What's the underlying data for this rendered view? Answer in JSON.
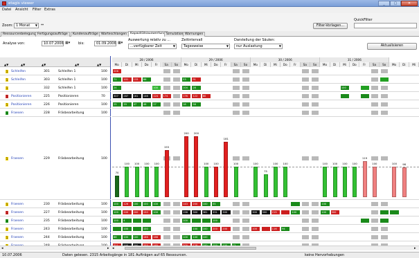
{
  "window": {
    "title": "etagis viewer"
  },
  "menu": [
    "Datei",
    "Ansicht",
    "Filter",
    "Extras"
  ],
  "toolbar": {
    "zoom_label": "Zoom:",
    "zoom_value": "1 Monat",
    "filter_button": "Filter-Vorlagen...",
    "quickfilter_label": "QuickFilter",
    "quickfilter_value": ""
  },
  "tabs": [
    {
      "label": "Ressourcenbelegung",
      "active": false
    },
    {
      "label": "Fertigungsaufträge",
      "active": false
    },
    {
      "label": "Kundenaufträge",
      "active": false
    },
    {
      "label": "Warteschlangen",
      "active": false
    },
    {
      "label": "Kapazitätsauswertung",
      "active": true
    },
    {
      "label": "Simulation",
      "active": false
    },
    {
      "label": "Warnungen",
      "active": false
    }
  ],
  "filters": {
    "analyse_label": "Analyse von:",
    "analyse_value": "10.07.2006",
    "bis_label": "bis:",
    "bis_value": "01.09.2006",
    "auswertung_label": "Auswertung relativ zu ...",
    "auswertung_value": "...verfügbarer Zeit",
    "zeitintervall_label": "Zeitintervall",
    "zeitintervall_value": "Tagesweise",
    "darstellung_label": "Darstellung der Säulen:",
    "darstellung_value": "nur Auslastung",
    "refresh_button": "Aktualisieren"
  },
  "weeks": [
    "28 / 2006",
    "29 / 2006",
    "30 / 2006",
    "31 / 2006"
  ],
  "days": [
    "Mo",
    "Di",
    "Mi",
    "Do",
    "Fr",
    "Sa",
    "So",
    "Mo",
    "Di",
    "Mi",
    "Do",
    "Fr",
    "Sa",
    "So",
    "Mo",
    "Di",
    "Mi",
    "Do",
    "Fr",
    "Sa",
    "So",
    "Mo",
    "Di",
    "Mi",
    "Do",
    "Fr",
    "Sa",
    "So",
    "Mo",
    "Di",
    "Mi"
  ],
  "rows": [
    {
      "pri": "1",
      "pri_color": "#f0d000",
      "name": "Schleifen",
      "nr": "301",
      "desc": "Schleifen 1",
      "cap": "100",
      "segs": [
        [
          "#cc1f1f",
          "206",
          0
        ]
      ]
    },
    {
      "pri": "1",
      "pri_color": "#f0d000",
      "name": "Schleifen",
      "nr": "303",
      "desc": "Schleifen 1",
      "cap": "100",
      "segs": [
        [
          "#1a8a1a",
          "71",
          0
        ],
        [
          "#cc1f1f",
          "101",
          1
        ],
        [
          "#cc1f1f",
          "133",
          2
        ],
        [
          "#1a8a1a",
          "66",
          3
        ],
        [
          "#1a8a1a",
          "53",
          7
        ],
        [
          "#cc1f1f",
          "91",
          8
        ],
        [
          "#22a022",
          "",
          27
        ]
      ]
    },
    {
      "pri": "1",
      "pri_color": "#f0d000",
      "name": "",
      "nr": "332",
      "desc": "Schleifen 1",
      "cap": "100",
      "segs": [
        [
          "#1a8a1a",
          "24",
          0
        ],
        [
          "#33b533",
          "100",
          4
        ],
        [
          "#1a8a1a",
          "104",
          7
        ],
        [
          "#1a8a1a",
          "28",
          8
        ],
        [
          "#1a8a1a",
          "100",
          23
        ],
        [
          "#22a022",
          "",
          25
        ]
      ]
    },
    {
      "pri": "1",
      "pri_color": "#e03030",
      "name": "Positionieren",
      "nr": "225",
      "desc": "Positionieren",
      "cap": "70",
      "segs": [
        [
          "#111",
          "307",
          0
        ],
        [
          "#111",
          "287",
          1
        ],
        [
          "#111",
          "161",
          2
        ],
        [
          "#111",
          "146",
          3
        ],
        [
          "#cc1f1f",
          "124",
          4
        ],
        [
          "#cc1f1f",
          "174",
          5
        ],
        [
          "#cc1f1f",
          "176",
          7
        ],
        [
          "#cc1f1f",
          "122",
          8
        ],
        [
          "#cc1f1f",
          "80",
          9
        ],
        [
          "#1a8a1a",
          "",
          23
        ],
        [
          "#1a8a1a",
          "",
          25
        ]
      ]
    },
    {
      "pri": "1",
      "pri_color": "#f0d000",
      "name": "Positionieren",
      "nr": "226",
      "desc": "Positionieren",
      "cap": "100",
      "segs": [
        [
          "#1a8a1a",
          "25",
          0
        ],
        [
          "#1a8a1a",
          "39",
          1
        ],
        [
          "#1a8a1a",
          "47",
          2
        ],
        [
          "#1a8a1a",
          "48",
          3
        ],
        [
          "#1a8a1a",
          "27",
          4
        ],
        [
          "#1a8a1a",
          "18",
          7
        ],
        [
          "#1a8a1a",
          "58",
          8
        ]
      ]
    },
    {
      "pri": "1",
      "pri_color": "#22a022",
      "name": "Fraesen",
      "nr": "228",
      "desc": "Fräsbearbeitung",
      "cap": "100",
      "segs": []
    },
    {
      "pri": "1",
      "pri_color": "#f0d000",
      "name": "Fraesen",
      "nr": "229",
      "desc": "Fräsbearbeitung",
      "cap": "100",
      "segs": []
    },
    {
      "pri": "1",
      "pri_color": "#f0d000",
      "name": "Fraesen",
      "nr": "230",
      "desc": "Fräsbearbeitung",
      "cap": "100",
      "segs": [
        [
          "#1a8a1a",
          "100",
          0
        ],
        [
          "#cc1f1f",
          "126",
          1
        ],
        [
          "#1a8a1a",
          "100",
          2
        ],
        [
          "#1a8a1a",
          "100",
          3
        ],
        [
          "#1a8a1a",
          "100",
          4
        ],
        [
          "#cc1f1f",
          "143",
          7
        ],
        [
          "#cc1f1f",
          "200",
          8
        ],
        [
          "#1a8a1a",
          "100",
          9
        ],
        [
          "#1a8a1a",
          "55",
          10
        ],
        [
          "#1a8a1a",
          "",
          18
        ],
        [
          "#1a8a1a",
          "100",
          21
        ]
      ]
    },
    {
      "pri": "1",
      "pri_color": "#e03030",
      "name": "Fraesen",
      "nr": "227",
      "desc": "Fräsbearbeitung",
      "cap": "100",
      "segs": [
        [
          "#1a8a1a",
          "100",
          0
        ],
        [
          "#cc1f1f",
          "200",
          1
        ],
        [
          "#cc1f1f",
          "200",
          2
        ],
        [
          "#cc1f1f",
          "150",
          3
        ],
        [
          "#1a8a1a",
          "100",
          4
        ],
        [
          "#111",
          "158",
          7
        ],
        [
          "#111",
          "300",
          8
        ],
        [
          "#111",
          "361",
          9
        ],
        [
          "#111",
          "331",
          10
        ],
        [
          "#111",
          "300",
          11
        ],
        [
          "#111",
          "300",
          14
        ],
        [
          "#111",
          "300",
          15
        ],
        [
          "#cc1f1f",
          "215",
          16
        ],
        [
          "#cc1f1f",
          "",
          17
        ],
        [
          "#1a8a1a",
          "100",
          18
        ],
        [
          "#1a8a1a",
          "100",
          21
        ],
        [
          "#cc1f1f",
          "300",
          22
        ],
        [
          "#1a8a1a",
          "",
          27
        ],
        [
          "#1a8a1a",
          "",
          28
        ]
      ]
    },
    {
      "pri": "1",
      "pri_color": "#22a022",
      "name": "Fraesen",
      "nr": "235",
      "desc": "Fräsbearbeitung",
      "cap": "100",
      "segs": [
        [
          "#1a8a1a",
          "100",
          0
        ],
        [
          "#1a8a1a",
          "4",
          1
        ],
        [
          "#1a8a1a",
          "",
          2
        ],
        [
          "#1a8a1a",
          "",
          3
        ],
        [
          "#1a8a1a",
          "100",
          7
        ],
        [
          "#1a8a1a",
          "",
          8
        ],
        [
          "#1a8a1a",
          "",
          9
        ],
        [
          "#1a8a1a",
          "100",
          10
        ],
        [
          "#1a8a1a",
          "",
          25
        ],
        [
          "#1a8a1a",
          "",
          27
        ]
      ]
    },
    {
      "pri": "1",
      "pri_color": "#f0d000",
      "name": "Fraesen",
      "nr": "243",
      "desc": "Fräsbearbeitung",
      "cap": "100",
      "segs": [
        [
          "#1a8a1a",
          "",
          0
        ],
        [
          "#1a8a1a",
          "100",
          1
        ],
        [
          "#1a8a1a",
          "",
          2
        ],
        [
          "#1a8a1a",
          "100",
          3
        ],
        [
          "#1a8a1a",
          "100",
          8
        ],
        [
          "#1a8a1a",
          "100",
          9
        ],
        [
          "#cc1f1f",
          "200",
          10
        ],
        [
          "#cc1f1f",
          "200",
          11
        ],
        [
          "#cc1f1f",
          "100",
          14
        ],
        [
          "#cc1f1f",
          "",
          15
        ],
        [
          "#cc1f1f",
          "116",
          16
        ],
        [
          "#1a8a1a",
          "94",
          17
        ]
      ]
    },
    {
      "pri": "1",
      "pri_color": "#f0d000",
      "name": "Fraesen",
      "nr": "244",
      "desc": "Fräsbearbeitung",
      "cap": "100",
      "segs": [
        [
          "#1a8a1a",
          "86",
          0
        ],
        [
          "#1a8a1a",
          "100",
          1
        ],
        [
          "#1a8a1a",
          "100",
          2
        ],
        [
          "#cc1f1f",
          "166",
          3
        ],
        [
          "#cc1f1f",
          "166",
          4
        ],
        [
          "#1a8a1a",
          "100",
          7
        ],
        [
          "#1a8a1a",
          "100",
          8
        ],
        [
          "#1a8a1a",
          "100",
          9
        ]
      ]
    },
    {
      "pri": "1",
      "pri_color": "#f0d000",
      "name": "Fraesen",
      "nr": "248",
      "desc": "Fräsbearbeitung",
      "cap": "100",
      "segs": [
        [
          "#cc1f1f",
          "311",
          0
        ],
        [
          "#111",
          "200",
          1
        ],
        [
          "#111",
          "200",
          2
        ],
        [
          "#cc1f1f",
          "255",
          3
        ],
        [
          "#cc1f1f",
          "165",
          4
        ],
        [
          "#cc1f1f",
          "200",
          7
        ],
        [
          "#cc1f1f",
          "128",
          8
        ],
        [
          "#1a8a1a",
          "100",
          9
        ],
        [
          "#1a8a1a",
          "100",
          10
        ],
        [
          "#1a8a1a",
          "100",
          11
        ],
        [
          "#1a8a1a",
          "13",
          12
        ]
      ]
    }
  ],
  "big_chart": {
    "labels": [
      "70",
      "100",
      "100",
      "100",
      "100",
      "155",
      "200",
      "200",
      "100",
      "100",
      "181",
      "100",
      "100",
      "75",
      "100",
      "100",
      "100",
      "100",
      "100",
      "100",
      "119",
      "100",
      "100",
      "98"
    ],
    "values": [
      70,
      100,
      100,
      100,
      100,
      155,
      200,
      200,
      100,
      100,
      181,
      100,
      100,
      75,
      100,
      100,
      100,
      100,
      100,
      100,
      119,
      100,
      100,
      98
    ],
    "colors": [
      "#1a6a1a",
      "#33c033",
      "#33c033",
      "#33c033",
      "#33c033",
      "#e02020",
      "#e02020",
      "#e02020",
      "#33c033",
      "#e02020",
      "#e02020",
      "#33c033",
      "#33c033",
      "#33c033",
      "#33c033",
      "#33c033",
      "#33c033",
      "#33c033",
      "#33c033",
      "#33c033",
      "#f08080",
      "#f08080",
      "#f08080",
      "#f08080"
    ],
    "day_index": [
      0,
      1,
      2,
      3,
      4,
      5,
      7,
      8,
      9,
      10,
      11,
      12,
      14,
      15,
      16,
      17,
      21,
      22,
      23,
      24,
      25,
      26,
      28,
      29
    ]
  },
  "status": {
    "date": "10.07.2006",
    "message": "Daten gelesen. 2315 Arbeitsgänge in 181 Aufträgen auf 65 Ressourcen.",
    "highlight": "keine Hervorhebungen"
  }
}
